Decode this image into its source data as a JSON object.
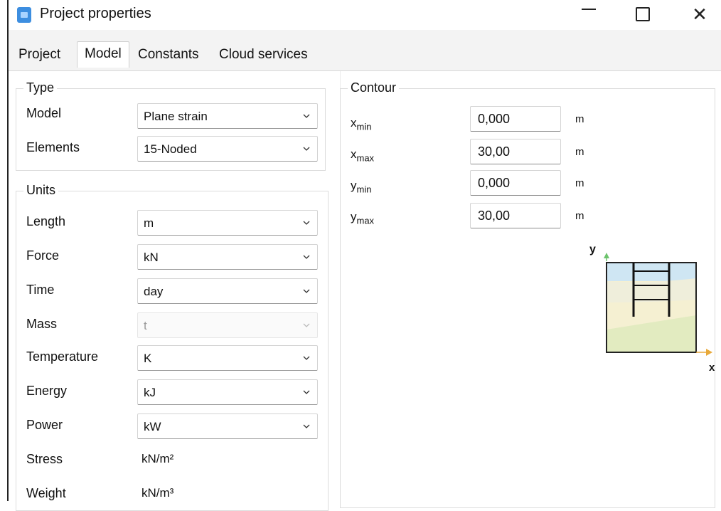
{
  "window": {
    "title": "Project properties",
    "controls": {
      "minimize": "—",
      "maximize": "☐",
      "close": "✕"
    }
  },
  "tabs": [
    {
      "label": "Project",
      "active": false
    },
    {
      "label": "Model",
      "active": true
    },
    {
      "label": "Constants",
      "active": false
    },
    {
      "label": "Cloud services",
      "active": false
    }
  ],
  "type_group": {
    "title": "Type",
    "model": {
      "label": "Model",
      "value": "Plane strain"
    },
    "elements": {
      "label": "Elements",
      "value": "15-Noded"
    }
  },
  "units_group": {
    "title": "Units",
    "length": {
      "label": "Length",
      "value": "m"
    },
    "force": {
      "label": "Force",
      "value": "kN"
    },
    "time": {
      "label": "Time",
      "value": "day"
    },
    "mass": {
      "label": "Mass",
      "value": "t",
      "disabled": true
    },
    "temperature": {
      "label": "Temperature",
      "value": "K"
    },
    "energy": {
      "label": "Energy",
      "value": "kJ"
    },
    "power": {
      "label": "Power",
      "value": "kW"
    },
    "stress": {
      "label": "Stress",
      "value": "kN/m²"
    },
    "weight": {
      "label": "Weight",
      "value": "kN/m³"
    }
  },
  "contour_group": {
    "title": "Contour",
    "xmin": {
      "var": "x",
      "sub": "min",
      "value": "0,000",
      "unit": "m"
    },
    "xmax": {
      "var": "x",
      "sub": "max",
      "value": "30,00",
      "unit": "m"
    },
    "ymin": {
      "var": "y",
      "sub": "min",
      "value": "0,000",
      "unit": "m"
    },
    "ymax": {
      "var": "y",
      "sub": "max",
      "value": "30,00",
      "unit": "m"
    }
  },
  "preview": {
    "y_axis_label": "y",
    "x_axis_label": "x",
    "colors": {
      "sky": "#cfe6f3",
      "soil_light": "#f5f0d2",
      "soil_green": "#e2ebc0",
      "axis": "#e8a93a",
      "axis_y": "#6cc36c"
    }
  }
}
